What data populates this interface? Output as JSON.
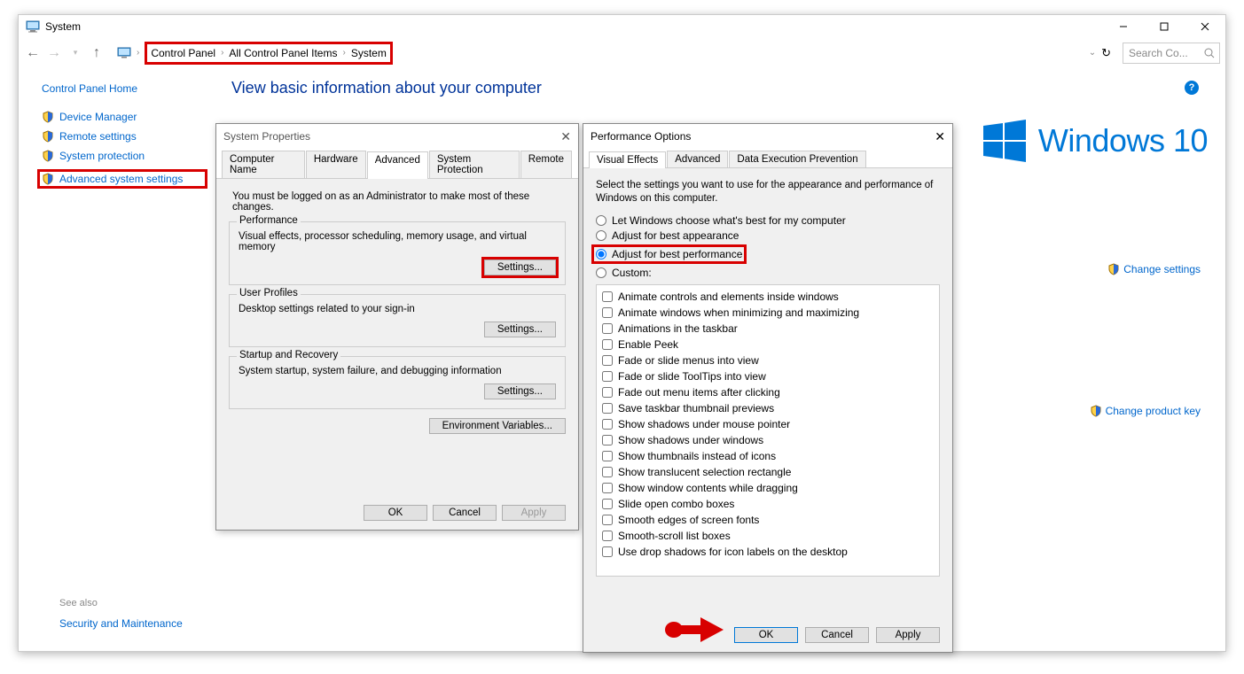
{
  "window": {
    "title": "System"
  },
  "nav": {
    "breadcrumb": [
      "Control Panel",
      "All Control Panel Items",
      "System"
    ],
    "search_placeholder": "Search Co..."
  },
  "sidebar": {
    "home": "Control Panel Home",
    "links": [
      {
        "label": "Device Manager"
      },
      {
        "label": "Remote settings"
      },
      {
        "label": "System protection"
      },
      {
        "label": "Advanced system settings"
      }
    ],
    "see_also": "See also",
    "security": "Security and Maintenance"
  },
  "main": {
    "heading": "View basic information about your computer",
    "win10": "Windows 10",
    "change_settings": "Change settings",
    "change_product_key": "Change product key"
  },
  "dlg_sysprops": {
    "title": "System Properties",
    "tabs": [
      "Computer Name",
      "Hardware",
      "Advanced",
      "System Protection",
      "Remote"
    ],
    "active_tab": "Advanced",
    "admin_msg": "You must be logged on as an Administrator to make most of these changes.",
    "groups": [
      {
        "title": "Performance",
        "desc": "Visual effects, processor scheduling, memory usage, and virtual memory",
        "btn": "Settings..."
      },
      {
        "title": "User Profiles",
        "desc": "Desktop settings related to your sign-in",
        "btn": "Settings..."
      },
      {
        "title": "Startup and Recovery",
        "desc": "System startup, system failure, and debugging information",
        "btn": "Settings..."
      }
    ],
    "env_btn": "Environment Variables...",
    "footer": {
      "ok": "OK",
      "cancel": "Cancel",
      "apply": "Apply"
    }
  },
  "dlg_perf": {
    "title": "Performance Options",
    "tabs": [
      "Visual Effects",
      "Advanced",
      "Data Execution Prevention"
    ],
    "active_tab": "Visual Effects",
    "msg": "Select the settings you want to use for the appearance and performance of Windows on this computer.",
    "radios": [
      "Let Windows choose what's best for my computer",
      "Adjust for best appearance",
      "Adjust for best performance",
      "Custom:"
    ],
    "selected_radio": 2,
    "checks": [
      "Animate controls and elements inside windows",
      "Animate windows when minimizing and maximizing",
      "Animations in the taskbar",
      "Enable Peek",
      "Fade or slide menus into view",
      "Fade or slide ToolTips into view",
      "Fade out menu items after clicking",
      "Save taskbar thumbnail previews",
      "Show shadows under mouse pointer",
      "Show shadows under windows",
      "Show thumbnails instead of icons",
      "Show translucent selection rectangle",
      "Show window contents while dragging",
      "Slide open combo boxes",
      "Smooth edges of screen fonts",
      "Smooth-scroll list boxes",
      "Use drop shadows for icon labels on the desktop"
    ],
    "footer": {
      "ok": "OK",
      "cancel": "Cancel",
      "apply": "Apply"
    }
  }
}
